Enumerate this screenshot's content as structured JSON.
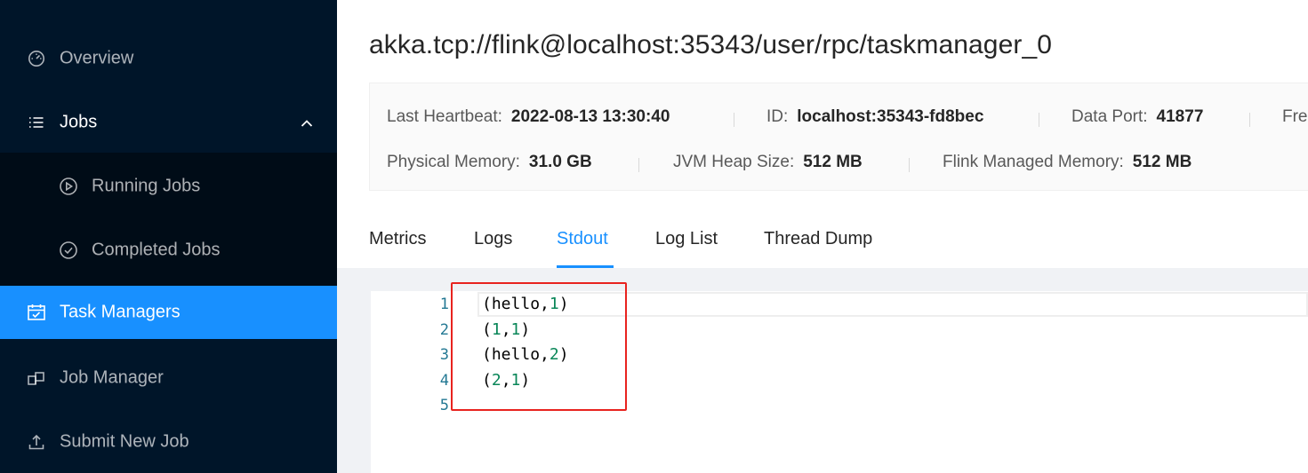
{
  "sidebar": {
    "items": [
      {
        "label": "Overview",
        "icon": "dashboard-icon"
      },
      {
        "label": "Jobs",
        "icon": "list-icon"
      },
      {
        "label": "Running Jobs",
        "icon": "play-circle-icon"
      },
      {
        "label": "Completed Jobs",
        "icon": "check-circle-icon"
      },
      {
        "label": "Task Managers",
        "icon": "schedule-icon"
      },
      {
        "label": "Job Manager",
        "icon": "cluster-icon"
      },
      {
        "label": "Submit New Job",
        "icon": "upload-icon"
      }
    ]
  },
  "main": {
    "title": "akka.tcp://flink@localhost:35343/user/rpc/taskmanager_0",
    "details": {
      "last_heartbeat": {
        "label": "Last Heartbeat:",
        "value": "2022-08-13 13:30:40"
      },
      "id": {
        "label": "ID:",
        "value": "localhost:35343-fd8bec"
      },
      "data_port": {
        "label": "Data Port:",
        "value": "41877"
      },
      "free_truncated": {
        "label": "Fre"
      },
      "physical_memory": {
        "label": "Physical Memory:",
        "value": "31.0 GB"
      },
      "jvm_heap": {
        "label": "JVM Heap Size:",
        "value": "512 MB"
      },
      "flink_managed": {
        "label": "Flink Managed Memory:",
        "value": "512 MB"
      }
    },
    "tabs": [
      "Metrics",
      "Logs",
      "Stdout",
      "Log List",
      "Thread Dump"
    ],
    "active_tab": "Stdout",
    "editor": {
      "line_numbers": [
        "1",
        "2",
        "3",
        "4",
        "5"
      ],
      "lines": [
        {
          "open": "(",
          "word": "hello",
          "comma": ",",
          "num": "1",
          "close": ")"
        },
        {
          "open": "(",
          "num1": "1",
          "comma": ",",
          "num2": "1",
          "close": ")"
        },
        {
          "open": "(",
          "word": "hello",
          "comma": ",",
          "num": "2",
          "close": ")"
        },
        {
          "open": "(",
          "num1": "2",
          "comma": ",",
          "num2": "1",
          "close": ")"
        }
      ]
    }
  },
  "colors": {
    "sidebar_bg": "#001529",
    "submenu_bg": "#000c17",
    "accent": "#1890ff",
    "highlight_box": "#e8231f",
    "number_green": "#098658",
    "line_number": "#237893"
  }
}
